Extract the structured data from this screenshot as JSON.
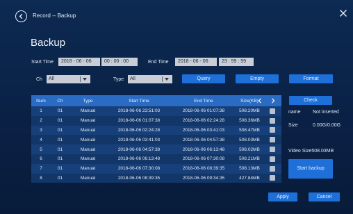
{
  "header": {
    "breadcrumb": "Record -- Backup",
    "title": "Backup"
  },
  "time": {
    "start_label": "Start Time",
    "start_date": "2018 - 06 - 06",
    "start_clock": "00 : 00 : 00",
    "end_label": "End Time",
    "end_date": "2018 - 06 - 06",
    "end_clock": "23 : 59 : 59"
  },
  "filters": {
    "ch_label": "Ch",
    "ch_value": "All",
    "type_label": "Type",
    "type_value": "All"
  },
  "buttons": {
    "query": "Query",
    "empty": "Empty",
    "format": "Format",
    "check": "Check",
    "start_backup": "Start backup",
    "apply": "Apply",
    "cancel": "Cancel"
  },
  "table": {
    "headers": [
      "Num",
      "Ch",
      "Type",
      "Start Time",
      "End Time",
      "Size(KB)"
    ],
    "rows": [
      [
        "1",
        "01",
        "Manual",
        "2018-06-06 23:51:03",
        "2018-06-06 01:07:38",
        "508.20MB"
      ],
      [
        "2",
        "01",
        "Manual",
        "2018-06-06 01:07:38",
        "2018-06-06 02:24:28",
        "508.36MB"
      ],
      [
        "3",
        "01",
        "Manual",
        "2018-06-06 02:24:28",
        "2018-06-06 03:41:03",
        "508.47MB"
      ],
      [
        "4",
        "01",
        "Manual",
        "2018-06-06 03:41:03",
        "2018-06-06 04:57:38",
        "508.03MB"
      ],
      [
        "5",
        "01",
        "Manual",
        "2018-06-06 04:57:38",
        "2018-06-06 06:13:48",
        "508.02MB"
      ],
      [
        "6",
        "01",
        "Manual",
        "2018-06-06 06:13:48",
        "2018-06-06 07:30:08",
        "508.21MB"
      ],
      [
        "7",
        "01",
        "Manual",
        "2018-06-06 07:30:08",
        "2018-06-06 08:39:35",
        "508.13MB"
      ],
      [
        "8",
        "01",
        "Manual",
        "2018-06-06 08:39:35",
        "2018-06-06 09:34:35",
        "427.84MB"
      ]
    ]
  },
  "device": {
    "name_label": "name",
    "name_value": "Not inserted",
    "size_label": "Size",
    "size_value": "0.00G/0.00G",
    "video_size": "Video Size508.03MB"
  },
  "colors": {
    "background": "#0b2244",
    "accent_button": "#1e6fd8",
    "table_header": "#2a6bc4",
    "field": "#c9ced6"
  }
}
